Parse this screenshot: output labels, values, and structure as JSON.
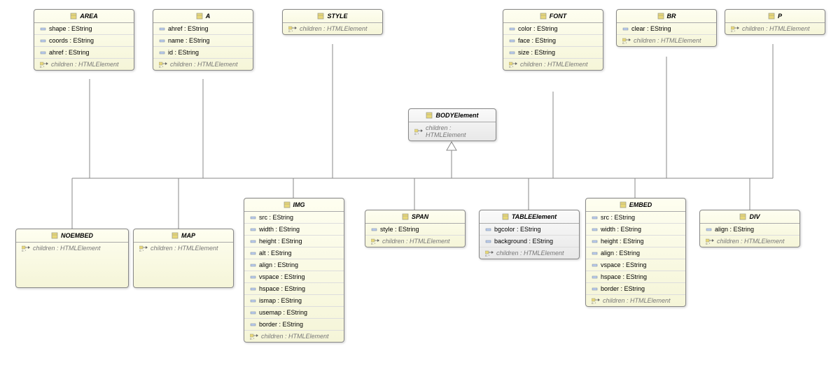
{
  "classes": {
    "AREA": {
      "name": "AREA",
      "attrs": [
        "shape : EString",
        "coords : EString",
        "ahref : EString"
      ],
      "ref": "children : HTMLElement"
    },
    "A": {
      "name": "A",
      "attrs": [
        "ahref : EString",
        "name : EString",
        "id : EString"
      ],
      "ref": "children : HTMLElement"
    },
    "STYLE": {
      "name": "STYLE",
      "attrs": [],
      "ref": "children : HTMLElement"
    },
    "FONT": {
      "name": "FONT",
      "attrs": [
        "color : EString",
        "face : EString",
        "size : EString"
      ],
      "ref": "children : HTMLElement"
    },
    "BR": {
      "name": "BR",
      "attrs": [
        "clear : EString"
      ],
      "ref": "children : HTMLElement"
    },
    "P": {
      "name": "P",
      "attrs": [],
      "ref": "children : HTMLElement"
    },
    "BODY": {
      "name": "BODYElement",
      "attrs": [],
      "ref": "children : HTMLElement"
    },
    "NOEMBED": {
      "name": "NOEMBED",
      "attrs": [],
      "ref": "children : HTMLElement"
    },
    "MAP": {
      "name": "MAP",
      "attrs": [],
      "ref": "children : HTMLElement"
    },
    "IMG": {
      "name": "IMG",
      "attrs": [
        "src : EString",
        "width : EString",
        "height : EString",
        "alt : EString",
        "align : EString",
        "vspace : EString",
        "hspace : EString",
        "ismap : EString",
        "usemap : EString",
        "border : EString"
      ],
      "ref": "children : HTMLElement"
    },
    "SPAN": {
      "name": "SPAN",
      "attrs": [
        "style : EString"
      ],
      "ref": "children : HTMLElement"
    },
    "TABLE": {
      "name": "TABLEElement",
      "attrs": [
        "bgcolor : EString",
        "background : EString"
      ],
      "ref": "children : HTMLElement"
    },
    "EMBED": {
      "name": "EMBED",
      "attrs": [
        "src : EString",
        "width : EString",
        "height : EString",
        "align : EString",
        "vspace : EString",
        "hspace : EString",
        "border : EString"
      ],
      "ref": "children : HTMLElement"
    },
    "DIV": {
      "name": "DIV",
      "attrs": [
        "align : EString"
      ],
      "ref": "children : HTMLElement"
    }
  }
}
